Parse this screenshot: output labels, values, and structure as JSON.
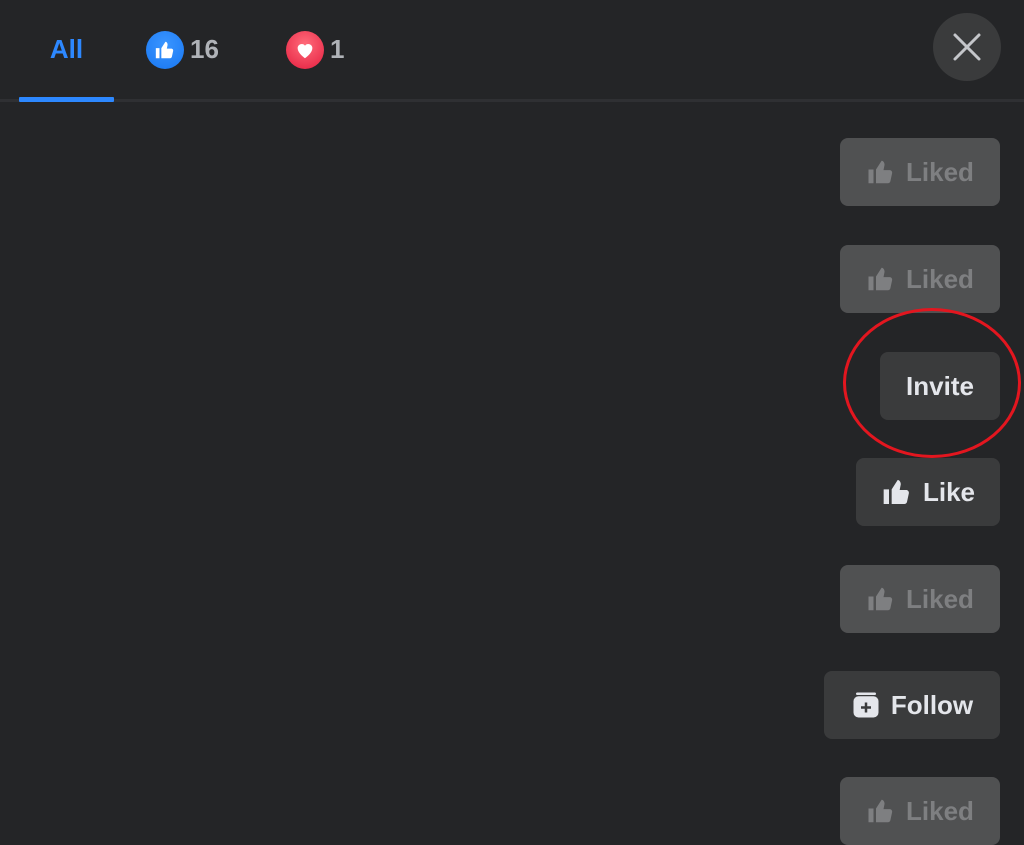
{
  "tabs": [
    {
      "label": "All",
      "active": true
    },
    {
      "reaction": "like",
      "icon": "thumbs-up-icon",
      "count": "16",
      "color": "#1877f2"
    },
    {
      "reaction": "love",
      "icon": "heart-icon",
      "count": "1",
      "color": "#e41e3f"
    }
  ],
  "close": {
    "icon": "close-icon"
  },
  "actions": [
    {
      "label": "Liked",
      "icon": "thumbs-up-icon",
      "state": "liked"
    },
    {
      "label": "Liked",
      "icon": "thumbs-up-icon",
      "state": "liked"
    },
    {
      "label": "Invite",
      "icon": null,
      "state": "normal",
      "highlighted": true
    },
    {
      "label": "Like",
      "icon": "thumbs-up-icon",
      "state": "normal"
    },
    {
      "label": "Liked",
      "icon": "thumbs-up-icon",
      "state": "liked"
    },
    {
      "label": "Follow",
      "icon": "follow-icon",
      "state": "normal"
    },
    {
      "label": "Liked",
      "icon": "thumbs-up-icon",
      "state": "liked"
    }
  ],
  "colors": {
    "accent": "#2d88ff",
    "background": "#242527",
    "button": "#3a3b3c",
    "liked_button": "#505152",
    "annotation": "#e3161f"
  }
}
